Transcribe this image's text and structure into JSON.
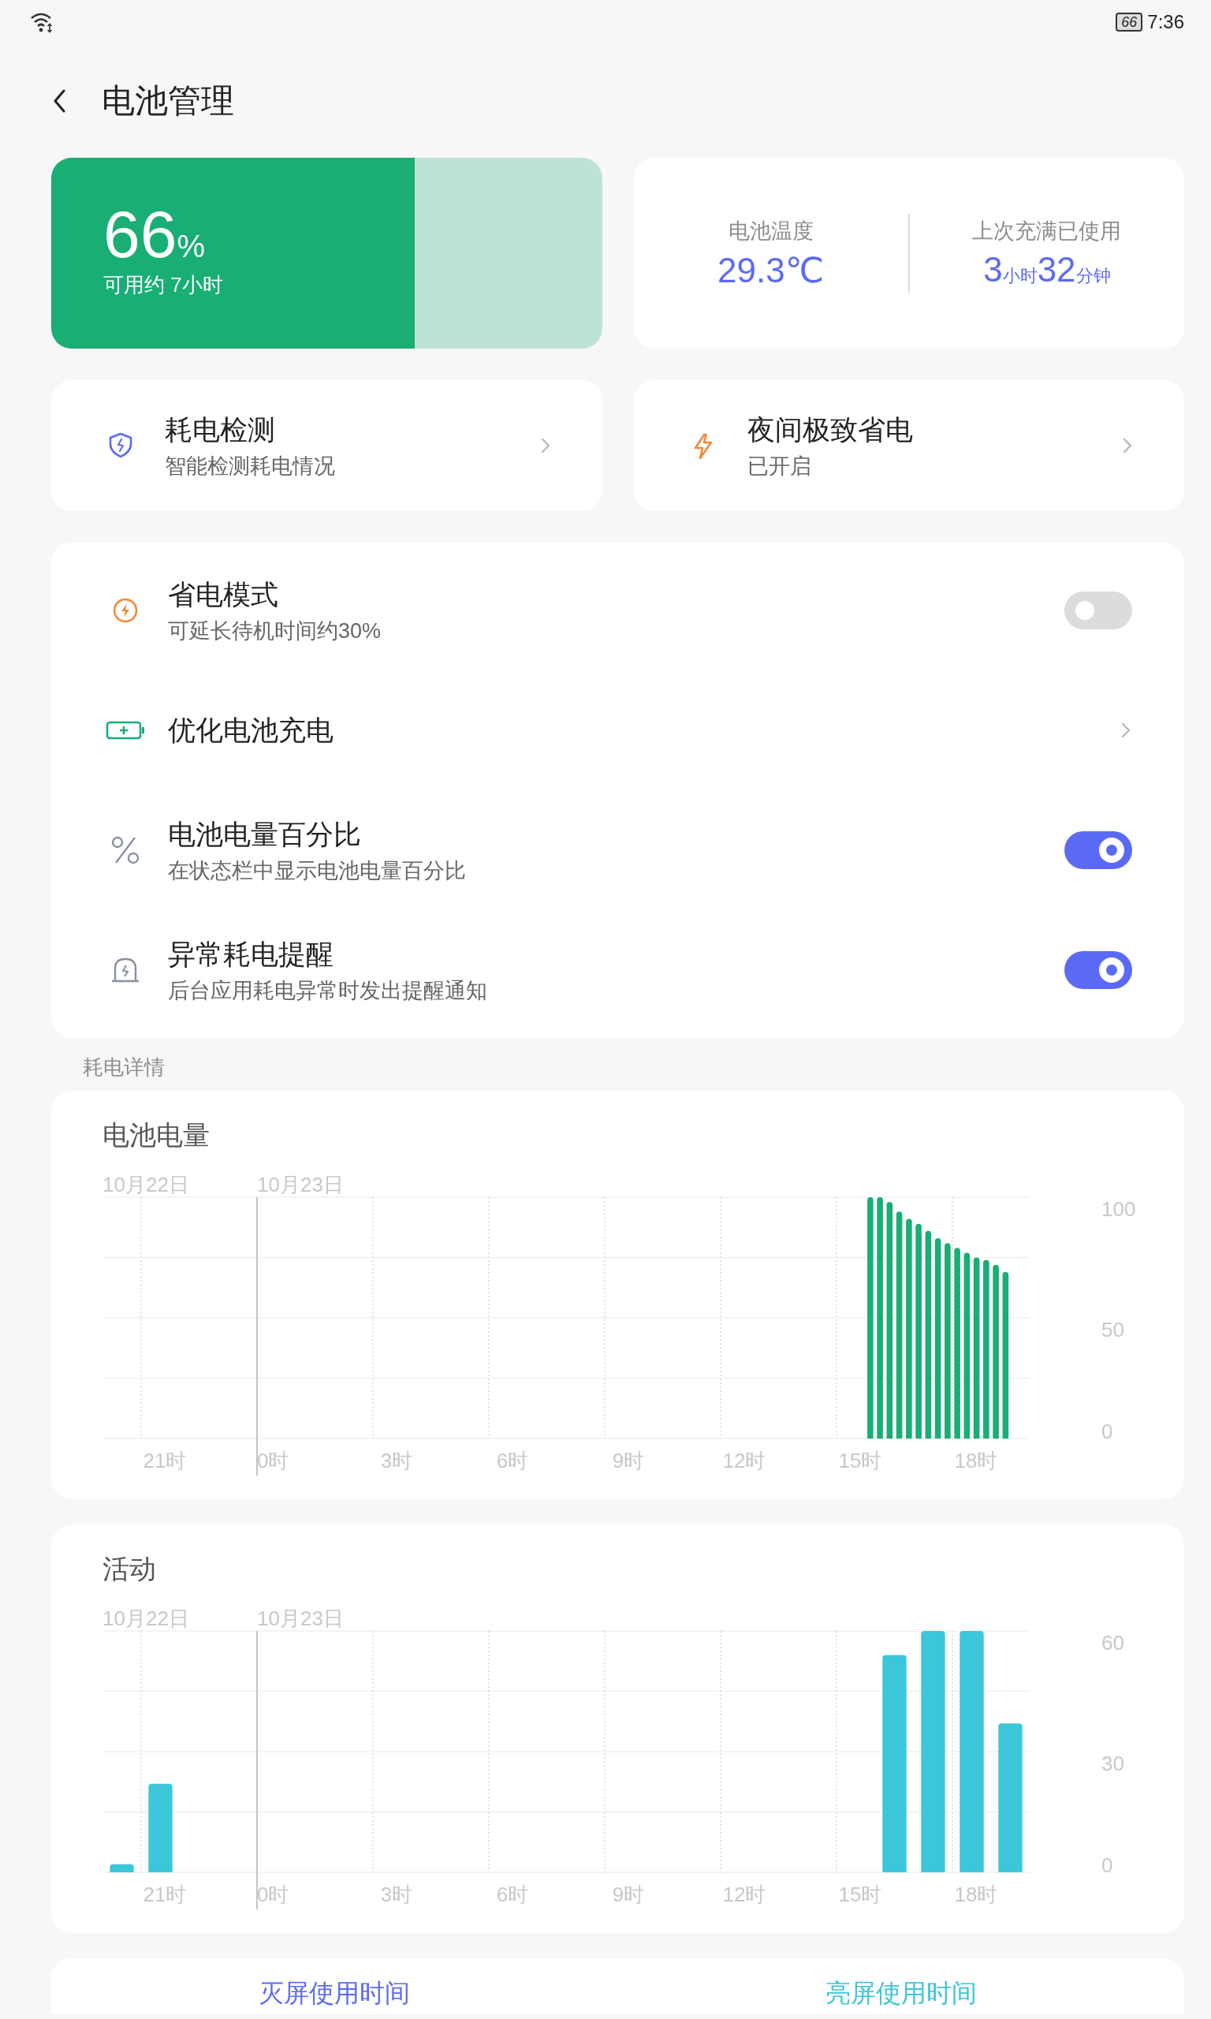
{
  "status_bar": {
    "battery": "66",
    "time": "7:36"
  },
  "header": {
    "title": "电池管理"
  },
  "battery_card": {
    "percent": "66",
    "unit": "%",
    "estimate": "可用约 7小时",
    "level": 0.66
  },
  "stats_card": {
    "items": [
      {
        "label": "电池温度",
        "parts": [
          {
            "text": "29.3℃",
            "kind": "number"
          }
        ]
      },
      {
        "label": "上次充满已使用",
        "parts": [
          {
            "text": "3",
            "kind": "number"
          },
          {
            "text": "小时",
            "kind": "unit"
          },
          {
            "text": "32",
            "kind": "number"
          },
          {
            "text": "分钟",
            "kind": "unit"
          }
        ]
      }
    ]
  },
  "shortcuts": [
    {
      "title": "耗电检测",
      "subtitle": "智能检测耗电情况"
    },
    {
      "title": "夜间极致省电",
      "subtitle": "已开启"
    }
  ],
  "settings": [
    {
      "kind": "toggle",
      "title": "省电模式",
      "subtitle": "可延长待机时间约30%",
      "on": false
    },
    {
      "kind": "link",
      "title": "优化电池充电"
    },
    {
      "kind": "toggle",
      "title": "电池电量百分比",
      "subtitle": "在状态栏中显示电池电量百分比",
      "on": true
    },
    {
      "kind": "toggle",
      "title": "异常耗电提醒",
      "subtitle": "后台应用耗电异常时发出提醒通知",
      "on": true
    }
  ],
  "section_label": "耗电详情",
  "charts": [
    {
      "title": "电池电量",
      "date_labels": [
        "10月22日",
        "10月23日"
      ],
      "chart_data": {
        "type": "bar",
        "color": "#19ae74",
        "categories": [
          null,
          null,
          null,
          null,
          null,
          null,
          "21时",
          null,
          null,
          null,
          null,
          null,
          null,
          null,
          null,
          null,
          null,
          "0时",
          null,
          null,
          null,
          null,
          null,
          null,
          null,
          null,
          null,
          null,
          null,
          null,
          "3时",
          null,
          null,
          null,
          null,
          null,
          null,
          null,
          null,
          null,
          null,
          null,
          "6时",
          null,
          null,
          null,
          null,
          null,
          null,
          null,
          null,
          null,
          null,
          null,
          "9时",
          null,
          null,
          null,
          null,
          null,
          null,
          null,
          null,
          null,
          null,
          null,
          "12时",
          null,
          null,
          null,
          null,
          null,
          null,
          null,
          null,
          null,
          null,
          null,
          "15时",
          null,
          null,
          null,
          null,
          null,
          null,
          null,
          null,
          null,
          null,
          null,
          "18时",
          null,
          null,
          null,
          null,
          null
        ],
        "values": [
          null,
          null,
          null,
          null,
          null,
          null,
          null,
          null,
          null,
          null,
          null,
          null,
          null,
          null,
          null,
          null,
          null,
          null,
          null,
          null,
          null,
          null,
          null,
          null,
          null,
          null,
          null,
          null,
          null,
          null,
          null,
          null,
          null,
          null,
          null,
          null,
          null,
          null,
          null,
          null,
          null,
          null,
          null,
          null,
          null,
          null,
          null,
          null,
          null,
          null,
          null,
          null,
          null,
          null,
          null,
          null,
          null,
          null,
          null,
          null,
          null,
          null,
          null,
          null,
          null,
          null,
          null,
          null,
          null,
          null,
          null,
          null,
          null,
          null,
          null,
          null,
          null,
          null,
          null,
          100,
          100,
          98,
          94,
          91,
          89,
          86,
          83,
          81,
          79,
          77,
          75,
          74,
          72,
          69,
          null,
          null
        ],
        "ylim": [
          0,
          100
        ],
        "yticks": [
          0,
          50,
          100
        ]
      }
    },
    {
      "title": "活动",
      "date_labels": [
        "10月22日",
        "10月23日"
      ],
      "chart_data": {
        "type": "bar",
        "color": "#3cc6da",
        "categories": [
          null,
          "21时",
          null,
          null,
          "0时",
          null,
          null,
          "3时",
          null,
          null,
          "6时",
          null,
          null,
          "9时",
          null,
          null,
          "12时",
          null,
          null,
          "15时",
          null,
          null,
          "18时",
          null
        ],
        "values": [
          2,
          22,
          null,
          null,
          null,
          null,
          null,
          null,
          null,
          null,
          null,
          null,
          null,
          null,
          null,
          null,
          null,
          null,
          null,
          null,
          54,
          60,
          60,
          37
        ],
        "ylim": [
          0,
          60
        ],
        "yticks": [
          0,
          30,
          60
        ]
      }
    }
  ],
  "usage_tabs": [
    {
      "label": "灭屏使用时间",
      "color": "#5b6af5"
    },
    {
      "label": "亮屏使用时间",
      "color": "#3cc6da"
    }
  ]
}
